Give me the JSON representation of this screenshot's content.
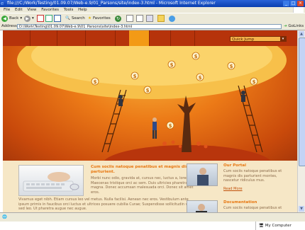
{
  "window": {
    "title": "file:///C:/Work/Testing/01.09.07/Web-e.9/01_Parsons/site/index-3.html - Microsoft Internet Explorer"
  },
  "menu": [
    "File",
    "Edit",
    "View",
    "Favorites",
    "Tools",
    "Help"
  ],
  "toolbar": {
    "back": "Back",
    "search": "Search",
    "favorites": "Favorites"
  },
  "address": {
    "label": "Address",
    "value": "D:\\Work\\Testing\\01.09.07\\Web-e.9\\01_Parsons\\site\\index-3.html",
    "go": "Go",
    "links": "Links"
  },
  "nav": {
    "quickjump": "Quick Jump"
  },
  "feature": {
    "title": "Cum sociis natoque penatibus et magnis dis parturient.",
    "body": "Morbi nunc odio, gravida at, cursus nec, luctus a, lorem. Maecenas tristique orci ac sem. Duis ultricies pharetra magna. Donec accumsan malesuada orci. Donec sit amet eros.",
    "wide_body": "Vivamus eget nibh. Etiam cursus leo vel metus. Nulla facilisi. Aenean nec eros. Vestibulum ante ipsum primis in faucibus orci luctus et ultrices posuere cubilia Curae; Suspendisse sollicitudin velit sed leo. Ut pharetra augue nec augue."
  },
  "sidebar": [
    {
      "title": "Our Portal",
      "body": "Cum sociis natoque penatibus et magnis dis parturient montes, nascetur ridiculus mus.",
      "more": "Read More"
    },
    {
      "title": "Documentation",
      "body": "Cum sociis natoque penatibus et"
    }
  ],
  "status": {
    "zone": "My Computer"
  },
  "colors": {
    "nav_bar": "#b6330b",
    "nav_active": "#f39a16",
    "accent_text": "#e7760f",
    "page_bg": "#f3e4c2"
  }
}
